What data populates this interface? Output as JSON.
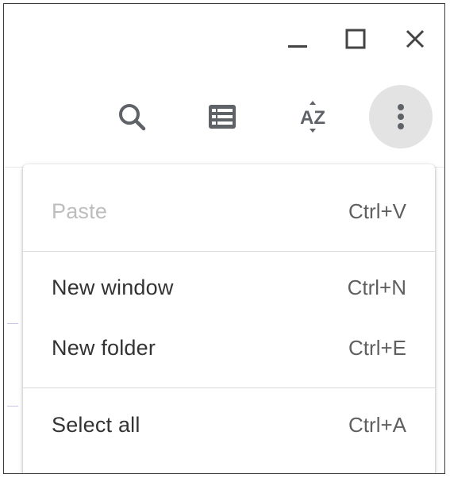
{
  "window_controls": {
    "minimize_icon": "minimize-icon",
    "maximize_icon": "maximize-icon",
    "close_icon": "close-icon"
  },
  "toolbar": {
    "buttons": [
      {
        "icon": "search-icon"
      },
      {
        "icon": "list-view-icon"
      },
      {
        "icon": "sort-az-icon",
        "glyph": "AZ"
      },
      {
        "icon": "more-vertical-icon",
        "active": true
      }
    ]
  },
  "menu": {
    "items": [
      {
        "label": "Paste",
        "shortcut": "Ctrl+V",
        "disabled": true
      },
      {
        "label": "New window",
        "shortcut": "Ctrl+N",
        "disabled": false
      },
      {
        "label": "New folder",
        "shortcut": "Ctrl+E",
        "disabled": false
      },
      {
        "label": "Select all",
        "shortcut": "Ctrl+A",
        "disabled": false
      }
    ]
  },
  "colors": {
    "icon": "#5f6368",
    "active_button_bg": "#e3e3e3",
    "disabled_text": "#bdbdbd",
    "text": "#333333"
  }
}
